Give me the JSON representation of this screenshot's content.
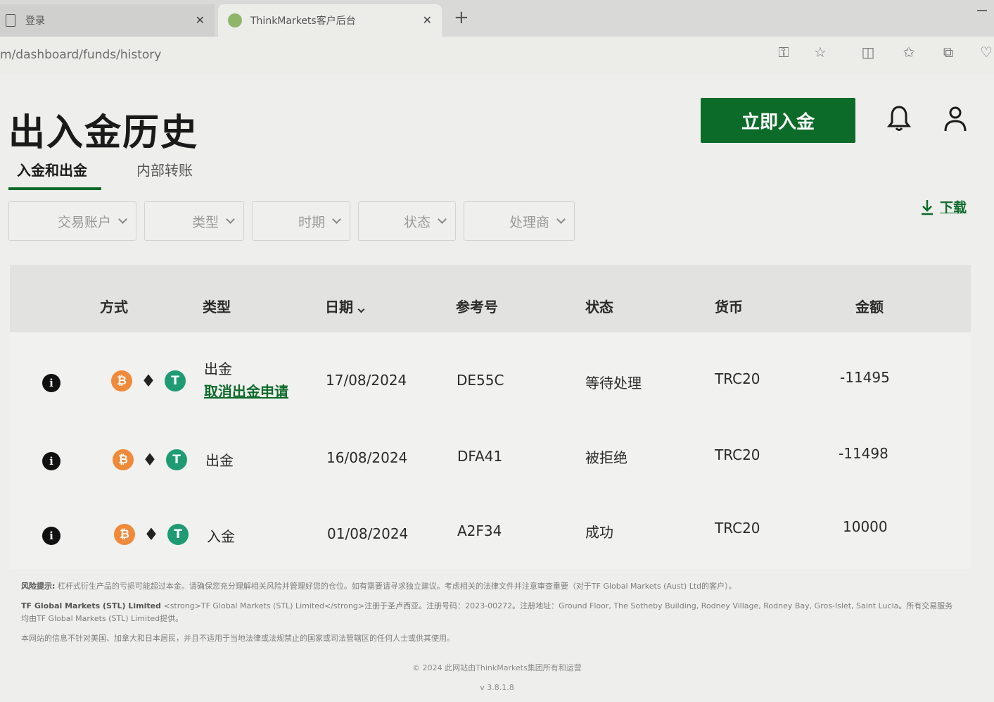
{
  "browser": {
    "tab1_title": "登录",
    "tab2_title": "ThinkMarkets客户后台",
    "url": "m/dashboard/funds/history"
  },
  "page": {
    "title": "出入金历史",
    "cta_label": "立即入金",
    "tabs": [
      "入金和出金",
      "内部转账"
    ],
    "filters": [
      "交易账户",
      "类型",
      "时期",
      "状态",
      "处理商"
    ],
    "download_label": "下载"
  },
  "table": {
    "headers": [
      "方式",
      "类型",
      "日期",
      "参考号",
      "状态",
      "货币",
      "金额"
    ],
    "rows": [
      {
        "type": "出金",
        "action": "取消出金申请",
        "date": "17/08/2024",
        "ref": "DE55C",
        "status": "等待处理",
        "currency": "TRC20",
        "amount": "-11495"
      },
      {
        "type": "出金",
        "action": "",
        "date": "16/08/2024",
        "ref": "DFA41",
        "status": "被拒绝",
        "currency": "TRC20",
        "amount": "-11498"
      },
      {
        "type": "入金",
        "action": "",
        "date": "01/08/2024",
        "ref": "A2F34",
        "status": "成功",
        "currency": "TRC20",
        "amount": "10000"
      }
    ]
  },
  "footer": {
    "risk_label": "风险提示:",
    "risk_text": "杠杆式衍生产品的亏损可能超过本金。请确保您充分理解相关风险并管理好您的仓位。如有需要请寻求独立建议。考虑相关的法律文件并注意审查重要（对于TF Global Markets (Aust) Ltd的客户）。",
    "entity_label": "TF Global Markets (STL) Limited",
    "entity_text": "<strong>TF Global Markets (STL) Limited</strong>注册于圣卢西亚。注册号码：2023-00272。注册地址：Ground Floor, The Sotheby Building, Rodney Village, Rodney Bay, Gros-Islet, Saint Lucia。所有交易服务均由TF Global Markets (STL) Limited提供。",
    "restriction_text": "本网站的信息不针对美国、加拿大和日本居民，并且不适用于当地法律或法规禁止的国家或司法管辖区的任何人士或供其使用。",
    "copyright": "© 2024 此网站由ThinkMarkets集团所有和运营",
    "version": "v 3.8.1.8"
  },
  "colors": {
    "brand_green": "#0d6b2a",
    "btc_orange": "#ef8a3a",
    "usdt_green": "#1f9b74"
  },
  "icons": [
    "document-icon",
    "tab-favicon",
    "close-icon",
    "plus-icon",
    "key-icon",
    "star-icon",
    "split-icon",
    "favorites-icon",
    "collections-icon",
    "heart-icon",
    "bell-icon",
    "user-icon",
    "download-icon",
    "info-icon",
    "bitcoin-icon",
    "ethereum-icon",
    "tether-icon",
    "chevron-down-icon"
  ]
}
